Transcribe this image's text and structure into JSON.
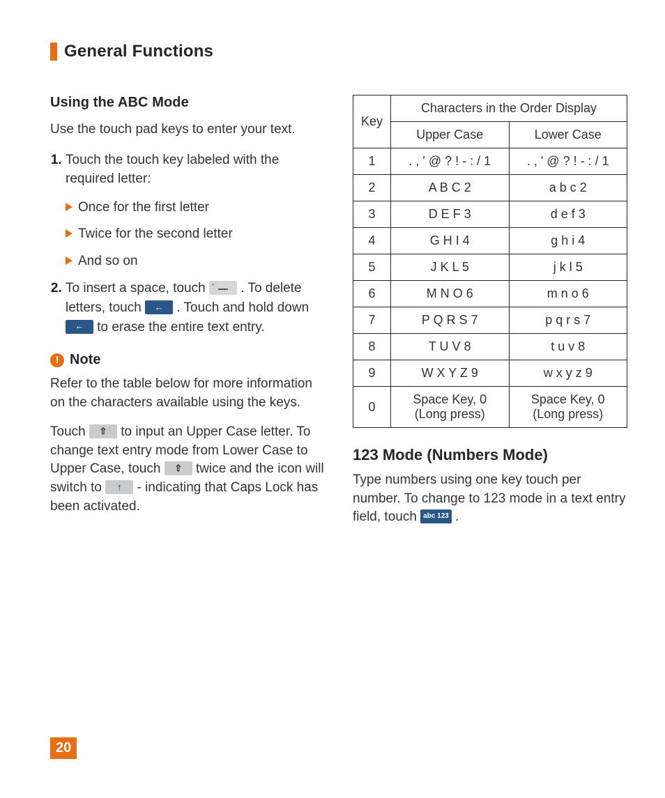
{
  "page": {
    "title": "General Functions",
    "number": "20"
  },
  "left": {
    "heading": "Using the ABC Mode",
    "intro": "Use the touch pad keys to enter your text.",
    "step1_text": "Touch the touch key labeled with the required letter:",
    "bullets": {
      "b1": "Once for the first letter",
      "b2": "Twice for the second letter",
      "b3": "And so on"
    },
    "step2": {
      "pre": "To insert a space, touch ",
      "mid1": ". To delete letters, touch ",
      "mid2": ". Touch and hold down ",
      "post": " to erase the entire text entry."
    },
    "note_label": "Note",
    "note_body": "Refer to the table below for more information on the characters available using the keys.",
    "caps": {
      "p1a": "Touch ",
      "p1b": " to input an Upper Case letter. To change text entry mode from Lower Case to Upper Case, touch ",
      "p1c": " twice and the icon will switch to ",
      "p1d": " - indicating that Caps Lock has been activated."
    }
  },
  "table": {
    "header_key": "Key",
    "header_span": "Characters in the Order Display",
    "header_upper": "Upper Case",
    "header_lower": "Lower Case",
    "rows": [
      {
        "k": "1",
        "u": ". , ' @ ? ! - : / 1",
        "l": ". , ' @ ? ! - : / 1"
      },
      {
        "k": "2",
        "u": "A B C 2",
        "l": "a b c 2"
      },
      {
        "k": "3",
        "u": "D E F 3",
        "l": "d e f 3"
      },
      {
        "k": "4",
        "u": "G H I 4",
        "l": "g h i 4"
      },
      {
        "k": "5",
        "u": "J K L 5",
        "l": "j k l 5"
      },
      {
        "k": "6",
        "u": "M N O 6",
        "l": "m n o 6"
      },
      {
        "k": "7",
        "u": "P Q R S 7",
        "l": "p q r s 7"
      },
      {
        "k": "8",
        "u": "T U V 8",
        "l": "t u v 8"
      },
      {
        "k": "9",
        "u": "W X Y Z 9",
        "l": "w x y z 9"
      },
      {
        "k": "0",
        "u": "Space Key, 0 (Long press)",
        "l": "Space Key, 0 (Long press)"
      }
    ]
  },
  "right": {
    "heading": "123 Mode (Numbers Mode)",
    "body_pre": "Type numbers using one key touch per number. To change to 123 mode in a text entry field, touch ",
    "body_post": ".",
    "mode_key_label": "abc 123"
  },
  "icons": {
    "space": "space-key-icon",
    "backspace": "backspace-key-icon",
    "shift": "shift-key-icon",
    "caps": "caps-lock-key-icon",
    "mode": "abc-123-mode-key-icon"
  }
}
